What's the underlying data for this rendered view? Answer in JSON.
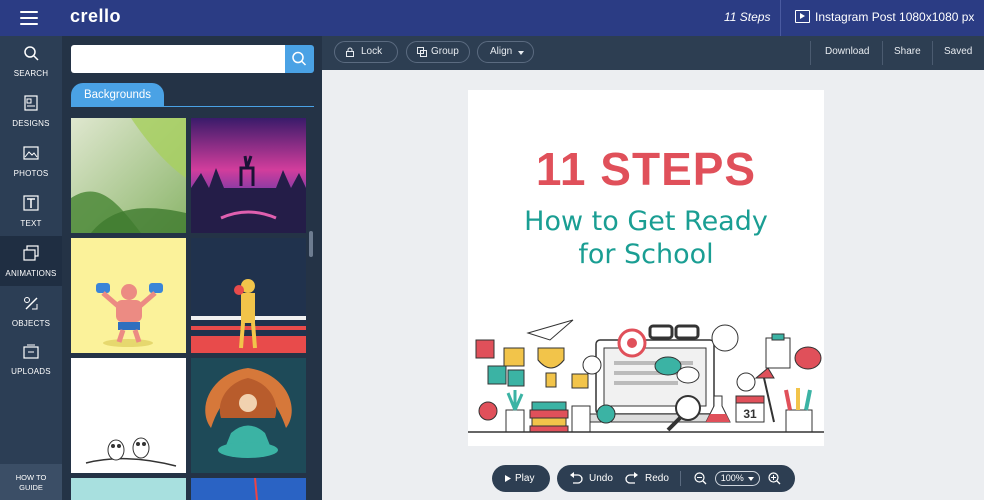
{
  "header": {
    "logo": "crello",
    "design_title": "11 Steps",
    "format": "Instagram Post 1080x1080 px"
  },
  "sidebar": {
    "items": [
      {
        "label": "SEARCH",
        "icon": "search-icon"
      },
      {
        "label": "DESIGNS",
        "icon": "designs-icon"
      },
      {
        "label": "PHOTOS",
        "icon": "photos-icon"
      },
      {
        "label": "TEXT",
        "icon": "text-icon"
      },
      {
        "label": "ANIMATIONS",
        "icon": "animations-icon",
        "active": true
      },
      {
        "label": "OBJECTS",
        "icon": "objects-icon"
      },
      {
        "label": "UPLOADS",
        "icon": "uploads-icon"
      }
    ],
    "how_to_line1": "HOW TO",
    "how_to_line2": "GUIDE"
  },
  "panel": {
    "search_value": "",
    "tab": "Backgrounds"
  },
  "toolbar": {
    "lock": "Lock",
    "group": "Group",
    "align": "Align",
    "download": "Download",
    "share": "Share",
    "saved": "Saved"
  },
  "canvas": {
    "title": "11 STEPS",
    "subtitle_line1": "How to Get Ready",
    "subtitle_line2": "for School"
  },
  "controls": {
    "play": "Play",
    "undo": "Undo",
    "redo": "Redo",
    "zoom": "100%"
  },
  "colors": {
    "header_bg": "#2b3c84",
    "accent": "#4aa2e5",
    "title_red": "#e0505a",
    "subtitle_teal": "#1a9e93"
  }
}
